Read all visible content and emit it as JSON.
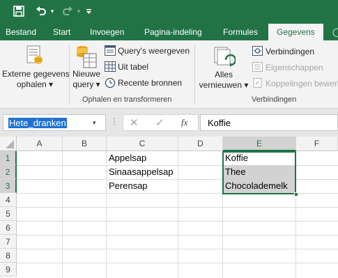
{
  "quick_access": {
    "save_icon": "save-icon",
    "undo_icon": "undo-icon",
    "redo_icon": "redo-icon",
    "customize_icon": "chevron-down-icon"
  },
  "tabs": [
    {
      "label": "Bestand"
    },
    {
      "label": "Start"
    },
    {
      "label": "Invoegen"
    },
    {
      "label": "Pagina-indeling"
    },
    {
      "label": "Formules"
    },
    {
      "label": "Gegevens",
      "active": true
    }
  ],
  "ribbon": {
    "externe": {
      "line1": "Externe gegevens",
      "line2": "ophalen ▾"
    },
    "nieuwe": {
      "line1": "Nieuwe",
      "line2": "query ▾"
    },
    "small1": [
      "Query's weergeven",
      "Uit tabel",
      "Recente bronnen"
    ],
    "group1_label": "Ophalen en transformeren",
    "alles": {
      "line1": "Alles",
      "line2": "vernieuwen ▾"
    },
    "small2": [
      "Verbindingen",
      "Eigenschappen",
      "Koppelingen bewerk"
    ],
    "group2_label": "Verbindingen"
  },
  "formula_bar": {
    "name_box": "Hete_dranken",
    "fx_label": "fx",
    "value": "Koffie"
  },
  "grid": {
    "columns": [
      "A",
      "B",
      "C",
      "D",
      "E",
      "F"
    ],
    "rows": [
      "1",
      "2",
      "3",
      "4",
      "5",
      "6",
      "7",
      "8",
      "9"
    ],
    "cells": {
      "C1": "Appelsap",
      "C2": "Sinaasappelsap",
      "C3": "Perensap",
      "E1": "Koffie",
      "E2": "Thee",
      "E3": "Chocolademelk"
    },
    "selected_column": "E",
    "selected_rows": [
      "1",
      "2",
      "3"
    ]
  },
  "colors": {
    "brand": "#217346",
    "ribbon_bg": "#f3f3f3",
    "selection_fill": "#d2d2d2",
    "name_highlight": "#1f72d2"
  }
}
